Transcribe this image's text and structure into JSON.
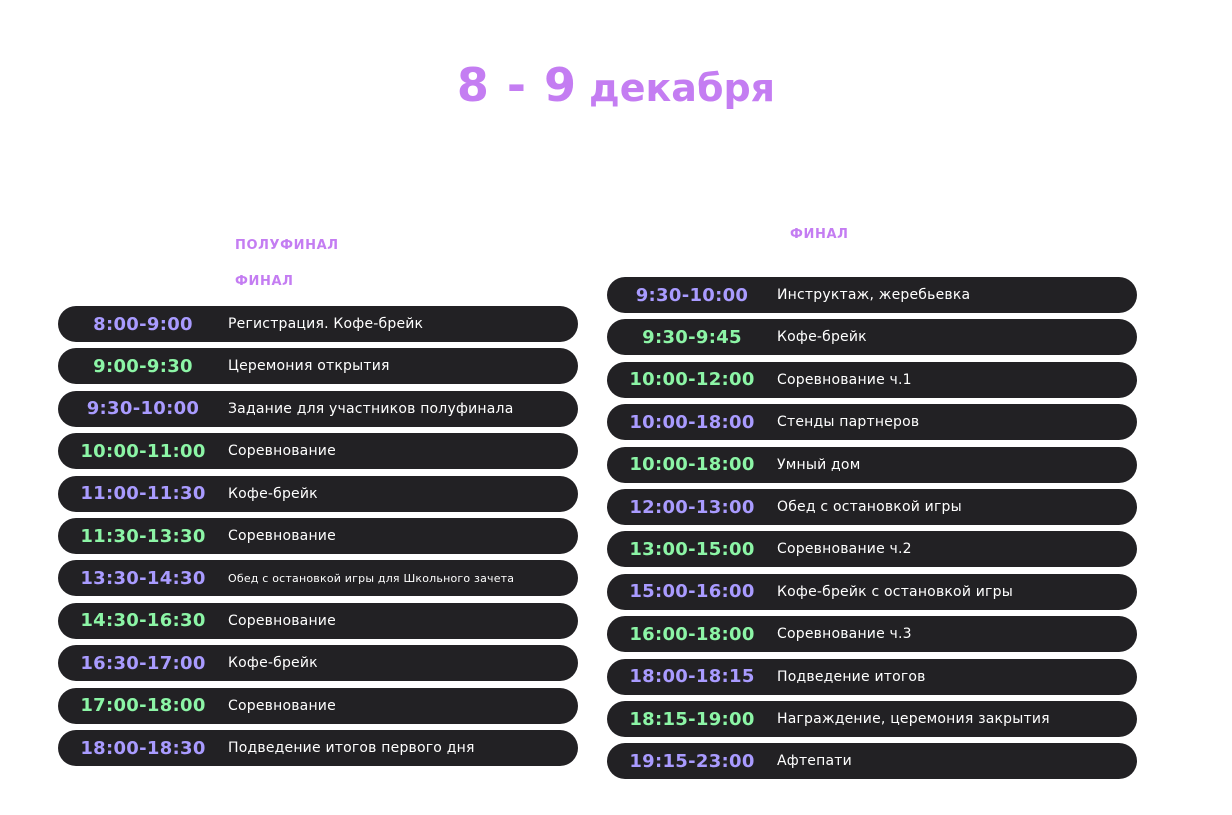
{
  "title": {
    "dates": "8 - 9",
    "month": "декабря"
  },
  "left": {
    "label_semifinal": "ПОЛУФИНАЛ",
    "label_final": "ФИНАЛ",
    "items": [
      {
        "time": "8:00-9:00",
        "desc": "Регистрация. Кофе-брейк",
        "time_color": "purple"
      },
      {
        "time": "9:00-9:30",
        "desc": "Церемония открытия",
        "time_color": "green"
      },
      {
        "time": "9:30-10:00",
        "desc": "Задание для участников полуфинала",
        "time_color": "purple"
      },
      {
        "time": "10:00-11:00",
        "desc": "Соревнование",
        "time_color": "green"
      },
      {
        "time": "11:00-11:30",
        "desc": "Кофе-брейк",
        "time_color": "purple"
      },
      {
        "time": "11:30-13:30",
        "desc": "Соревнование",
        "time_color": "green"
      },
      {
        "time": "13:30-14:30",
        "desc": "Обед с остановкой игры для Школьного зачета",
        "time_color": "purple"
      },
      {
        "time": "14:30-16:30",
        "desc": "Соревнование",
        "time_color": "green"
      },
      {
        "time": "16:30-17:00",
        "desc": "Кофе-брейк",
        "time_color": "purple"
      },
      {
        "time": "17:00-18:00",
        "desc": "Соревнование",
        "time_color": "green"
      },
      {
        "time": "18:00-18:30",
        "desc": "Подведение итогов первого дня",
        "time_color": "purple"
      }
    ]
  },
  "right": {
    "label_final": "ФИНАЛ",
    "items": [
      {
        "time": "9:30-10:00",
        "desc": "Инструктаж, жеребьевка",
        "time_color": "purple"
      },
      {
        "time": "9:30-9:45",
        "desc": "Кофе-брейк",
        "time_color": "green"
      },
      {
        "time": "10:00-12:00",
        "desc": "Соревнование ч.1",
        "time_color": "green"
      },
      {
        "time": "10:00-18:00",
        "desc": "Стенды партнеров",
        "time_color": "purple"
      },
      {
        "time": "10:00-18:00",
        "desc": "Умный дом",
        "time_color": "green"
      },
      {
        "time": "12:00-13:00",
        "desc": "Обед с остановкой игры",
        "time_color": "purple"
      },
      {
        "time": "13:00-15:00",
        "desc": "Соревнование ч.2",
        "time_color": "green"
      },
      {
        "time": "15:00-16:00",
        "desc": "Кофе-брейк с остановкой игры",
        "time_color": "purple"
      },
      {
        "time": "16:00-18:00",
        "desc": "Соревнование ч.3",
        "time_color": "green"
      },
      {
        "time": "18:00-18:15",
        "desc": "Подведение итогов",
        "time_color": "purple"
      },
      {
        "time": "18:15-19:00",
        "desc": "Награждение, церемония закрытия",
        "time_color": "green"
      },
      {
        "time": "19:15-23:00",
        "desc": "Афтепати",
        "time_color": "purple"
      }
    ]
  },
  "colors": {
    "accent": "#c47df2",
    "time_purple": "#a99bff",
    "time_green": "#8cf5a6",
    "row_bg": "#222124"
  }
}
